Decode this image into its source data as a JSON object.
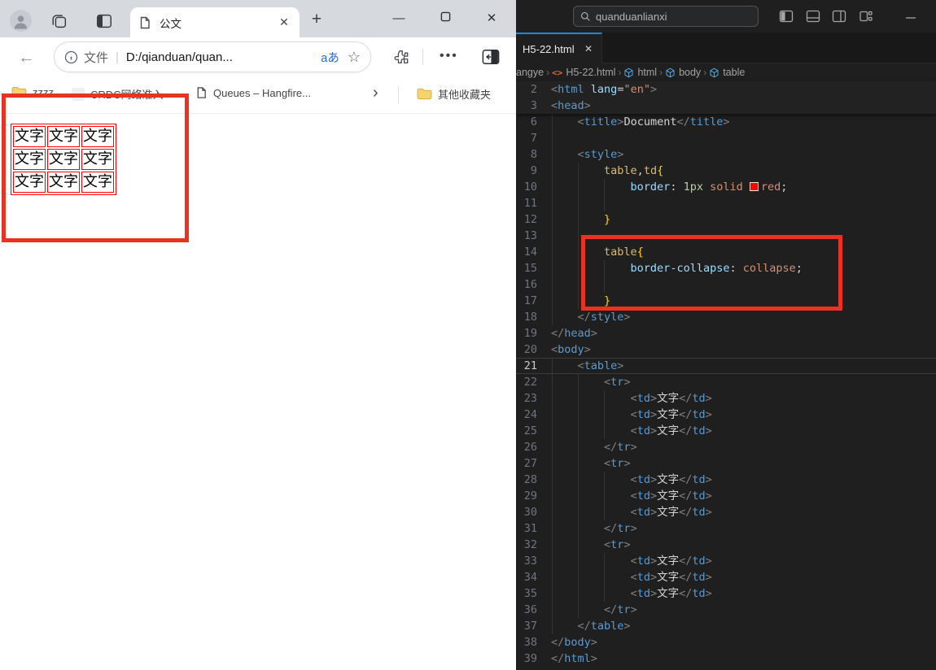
{
  "colors": {
    "annotation_red": "#ea3223",
    "table_border_red": "#ff0000",
    "css_swatch_red": "#ff0000",
    "vscode_tab_accent": "#2188d9"
  },
  "browser": {
    "tab": {
      "title": "公文"
    },
    "window_controls": {
      "minimize": "—",
      "maximize": "",
      "close": "✕",
      "new_tab": "+"
    },
    "toolbar": {
      "scheme_label": "文件",
      "url": "D:/qianduan/quan...",
      "translate_label": "aあ",
      "more_label": "•••"
    },
    "bookmarks": {
      "item_folder_1": "zzzz",
      "item_favicon": "CRDC网络准入",
      "item_page": "Queues – Hangfire...",
      "overflow_chevron": "›",
      "other_folder": "其他收藏夹"
    },
    "page": {
      "table_rows": [
        [
          "文字",
          "文字",
          "文字"
        ],
        [
          "文字",
          "文字",
          "文字"
        ],
        [
          "文字",
          "文字",
          "文字"
        ]
      ]
    }
  },
  "vscode": {
    "titlebar": {
      "search": "quanduanlianxi"
    },
    "tab": {
      "label": "H5-22.html",
      "close": "✕"
    },
    "breadcrumbs": [
      {
        "label": "angye",
        "icon": ""
      },
      {
        "label": "H5-22.html",
        "icon": "code"
      },
      {
        "label": "html",
        "icon": "cube"
      },
      {
        "label": "body",
        "icon": "cube"
      },
      {
        "label": "table",
        "icon": "cube"
      }
    ],
    "sticky": [
      {
        "n": 2,
        "g": 0,
        "t": [
          [
            "pt",
            "<"
          ],
          [
            "tg",
            "html"
          ],
          [
            "tx",
            " "
          ],
          [
            "at",
            "lang"
          ],
          [
            "eq",
            "="
          ],
          [
            "st",
            "\"en\""
          ],
          [
            "pt",
            ">"
          ]
        ]
      },
      {
        "n": 3,
        "g": 0,
        "t": [
          [
            "pt",
            "<"
          ],
          [
            "tg",
            "head"
          ],
          [
            "pt",
            ">"
          ]
        ]
      }
    ],
    "lines": [
      {
        "n": 6,
        "g": 1,
        "t": [
          [
            "tx",
            "    "
          ],
          [
            "pt",
            "<"
          ],
          [
            "tg",
            "title"
          ],
          [
            "pt",
            ">"
          ],
          [
            "tx",
            "Document"
          ],
          [
            "pt",
            "</"
          ],
          [
            "tg",
            "title"
          ],
          [
            "pt",
            ">"
          ]
        ]
      },
      {
        "n": 7,
        "g": 1,
        "t": []
      },
      {
        "n": 8,
        "g": 1,
        "t": [
          [
            "tx",
            "    "
          ],
          [
            "pt",
            "<"
          ],
          [
            "tg",
            "style"
          ],
          [
            "pt",
            ">"
          ]
        ]
      },
      {
        "n": 9,
        "g": 2,
        "t": [
          [
            "tx",
            "        "
          ],
          [
            "sl",
            "table"
          ],
          [
            "eq",
            ","
          ],
          [
            "sl",
            "td"
          ],
          [
            "br",
            "{"
          ]
        ]
      },
      {
        "n": 10,
        "g": 3,
        "t": [
          [
            "tx",
            "            "
          ],
          [
            "pr",
            "border"
          ],
          [
            "eq",
            ": "
          ],
          [
            "nu",
            "1px"
          ],
          [
            "tx",
            " "
          ],
          [
            "vl",
            "solid"
          ],
          [
            "tx",
            " "
          ],
          [
            "sw",
            ""
          ],
          [
            "vl",
            "red"
          ],
          [
            "eq",
            ";"
          ]
        ]
      },
      {
        "n": 11,
        "g": 3,
        "t": []
      },
      {
        "n": 12,
        "g": 2,
        "t": [
          [
            "tx",
            "        "
          ],
          [
            "br",
            "}"
          ]
        ]
      },
      {
        "n": 13,
        "g": 2,
        "t": []
      },
      {
        "n": 14,
        "g": 2,
        "t": [
          [
            "tx",
            "        "
          ],
          [
            "sl",
            "table"
          ],
          [
            "br",
            "{"
          ]
        ]
      },
      {
        "n": 15,
        "g": 3,
        "t": [
          [
            "tx",
            "            "
          ],
          [
            "pr",
            "border-collapse"
          ],
          [
            "eq",
            ": "
          ],
          [
            "vl",
            "collapse"
          ],
          [
            "eq",
            ";"
          ]
        ]
      },
      {
        "n": 16,
        "g": 3,
        "t": []
      },
      {
        "n": 17,
        "g": 2,
        "t": [
          [
            "tx",
            "        "
          ],
          [
            "br",
            "}"
          ]
        ]
      },
      {
        "n": 18,
        "g": 1,
        "t": [
          [
            "tx",
            "    "
          ],
          [
            "pt",
            "</"
          ],
          [
            "tg",
            "style"
          ],
          [
            "pt",
            ">"
          ]
        ]
      },
      {
        "n": 19,
        "g": 0,
        "t": [
          [
            "pt",
            "</"
          ],
          [
            "tg",
            "head"
          ],
          [
            "pt",
            ">"
          ]
        ]
      },
      {
        "n": 20,
        "g": 0,
        "t": [
          [
            "pt",
            "<"
          ],
          [
            "tg",
            "body"
          ],
          [
            "pt",
            ">"
          ]
        ]
      },
      {
        "n": 21,
        "g": 1,
        "cur": true,
        "t": [
          [
            "tx",
            "    "
          ],
          [
            "pt",
            "<"
          ],
          [
            "tg",
            "table"
          ],
          [
            "pt",
            ">"
          ]
        ]
      },
      {
        "n": 22,
        "g": 2,
        "t": [
          [
            "tx",
            "        "
          ],
          [
            "pt",
            "<"
          ],
          [
            "tg",
            "tr"
          ],
          [
            "pt",
            ">"
          ]
        ]
      },
      {
        "n": 23,
        "g": 3,
        "t": [
          [
            "tx",
            "            "
          ],
          [
            "pt",
            "<"
          ],
          [
            "tg",
            "td"
          ],
          [
            "pt",
            ">"
          ],
          [
            "tx",
            "文字"
          ],
          [
            "pt",
            "</"
          ],
          [
            "tg",
            "td"
          ],
          [
            "pt",
            ">"
          ]
        ]
      },
      {
        "n": 24,
        "g": 3,
        "t": [
          [
            "tx",
            "            "
          ],
          [
            "pt",
            "<"
          ],
          [
            "tg",
            "td"
          ],
          [
            "pt",
            ">"
          ],
          [
            "tx",
            "文字"
          ],
          [
            "pt",
            "</"
          ],
          [
            "tg",
            "td"
          ],
          [
            "pt",
            ">"
          ]
        ]
      },
      {
        "n": 25,
        "g": 3,
        "t": [
          [
            "tx",
            "            "
          ],
          [
            "pt",
            "<"
          ],
          [
            "tg",
            "td"
          ],
          [
            "pt",
            ">"
          ],
          [
            "tx",
            "文字"
          ],
          [
            "pt",
            "</"
          ],
          [
            "tg",
            "td"
          ],
          [
            "pt",
            ">"
          ]
        ]
      },
      {
        "n": 26,
        "g": 2,
        "t": [
          [
            "tx",
            "        "
          ],
          [
            "pt",
            "</"
          ],
          [
            "tg",
            "tr"
          ],
          [
            "pt",
            ">"
          ]
        ]
      },
      {
        "n": 27,
        "g": 2,
        "t": [
          [
            "tx",
            "        "
          ],
          [
            "pt",
            "<"
          ],
          [
            "tg",
            "tr"
          ],
          [
            "pt",
            ">"
          ]
        ]
      },
      {
        "n": 28,
        "g": 3,
        "t": [
          [
            "tx",
            "            "
          ],
          [
            "pt",
            "<"
          ],
          [
            "tg",
            "td"
          ],
          [
            "pt",
            ">"
          ],
          [
            "tx",
            "文字"
          ],
          [
            "pt",
            "</"
          ],
          [
            "tg",
            "td"
          ],
          [
            "pt",
            ">"
          ]
        ]
      },
      {
        "n": 29,
        "g": 3,
        "t": [
          [
            "tx",
            "            "
          ],
          [
            "pt",
            "<"
          ],
          [
            "tg",
            "td"
          ],
          [
            "pt",
            ">"
          ],
          [
            "tx",
            "文字"
          ],
          [
            "pt",
            "</"
          ],
          [
            "tg",
            "td"
          ],
          [
            "pt",
            ">"
          ]
        ]
      },
      {
        "n": 30,
        "g": 3,
        "t": [
          [
            "tx",
            "            "
          ],
          [
            "pt",
            "<"
          ],
          [
            "tg",
            "td"
          ],
          [
            "pt",
            ">"
          ],
          [
            "tx",
            "文字"
          ],
          [
            "pt",
            "</"
          ],
          [
            "tg",
            "td"
          ],
          [
            "pt",
            ">"
          ]
        ]
      },
      {
        "n": 31,
        "g": 2,
        "t": [
          [
            "tx",
            "        "
          ],
          [
            "pt",
            "</"
          ],
          [
            "tg",
            "tr"
          ],
          [
            "pt",
            ">"
          ]
        ]
      },
      {
        "n": 32,
        "g": 2,
        "t": [
          [
            "tx",
            "        "
          ],
          [
            "pt",
            "<"
          ],
          [
            "tg",
            "tr"
          ],
          [
            "pt",
            ">"
          ]
        ]
      },
      {
        "n": 33,
        "g": 3,
        "t": [
          [
            "tx",
            "            "
          ],
          [
            "pt",
            "<"
          ],
          [
            "tg",
            "td"
          ],
          [
            "pt",
            ">"
          ],
          [
            "tx",
            "文字"
          ],
          [
            "pt",
            "</"
          ],
          [
            "tg",
            "td"
          ],
          [
            "pt",
            ">"
          ]
        ]
      },
      {
        "n": 34,
        "g": 3,
        "t": [
          [
            "tx",
            "            "
          ],
          [
            "pt",
            "<"
          ],
          [
            "tg",
            "td"
          ],
          [
            "pt",
            ">"
          ],
          [
            "tx",
            "文字"
          ],
          [
            "pt",
            "</"
          ],
          [
            "tg",
            "td"
          ],
          [
            "pt",
            ">"
          ]
        ]
      },
      {
        "n": 35,
        "g": 3,
        "t": [
          [
            "tx",
            "            "
          ],
          [
            "pt",
            "<"
          ],
          [
            "tg",
            "td"
          ],
          [
            "pt",
            ">"
          ],
          [
            "tx",
            "文字"
          ],
          [
            "pt",
            "</"
          ],
          [
            "tg",
            "td"
          ],
          [
            "pt",
            ">"
          ]
        ]
      },
      {
        "n": 36,
        "g": 2,
        "t": [
          [
            "tx",
            "        "
          ],
          [
            "pt",
            "</"
          ],
          [
            "tg",
            "tr"
          ],
          [
            "pt",
            ">"
          ]
        ]
      },
      {
        "n": 37,
        "g": 1,
        "t": [
          [
            "tx",
            "    "
          ],
          [
            "pt",
            "</"
          ],
          [
            "tg",
            "table"
          ],
          [
            "pt",
            ">"
          ]
        ]
      },
      {
        "n": 38,
        "g": 0,
        "t": [
          [
            "pt",
            "</"
          ],
          [
            "tg",
            "body"
          ],
          [
            "pt",
            ">"
          ]
        ]
      },
      {
        "n": 39,
        "g": 0,
        "t": [
          [
            "pt",
            "</"
          ],
          [
            "tg",
            "html"
          ],
          [
            "pt",
            ">"
          ]
        ]
      }
    ]
  }
}
